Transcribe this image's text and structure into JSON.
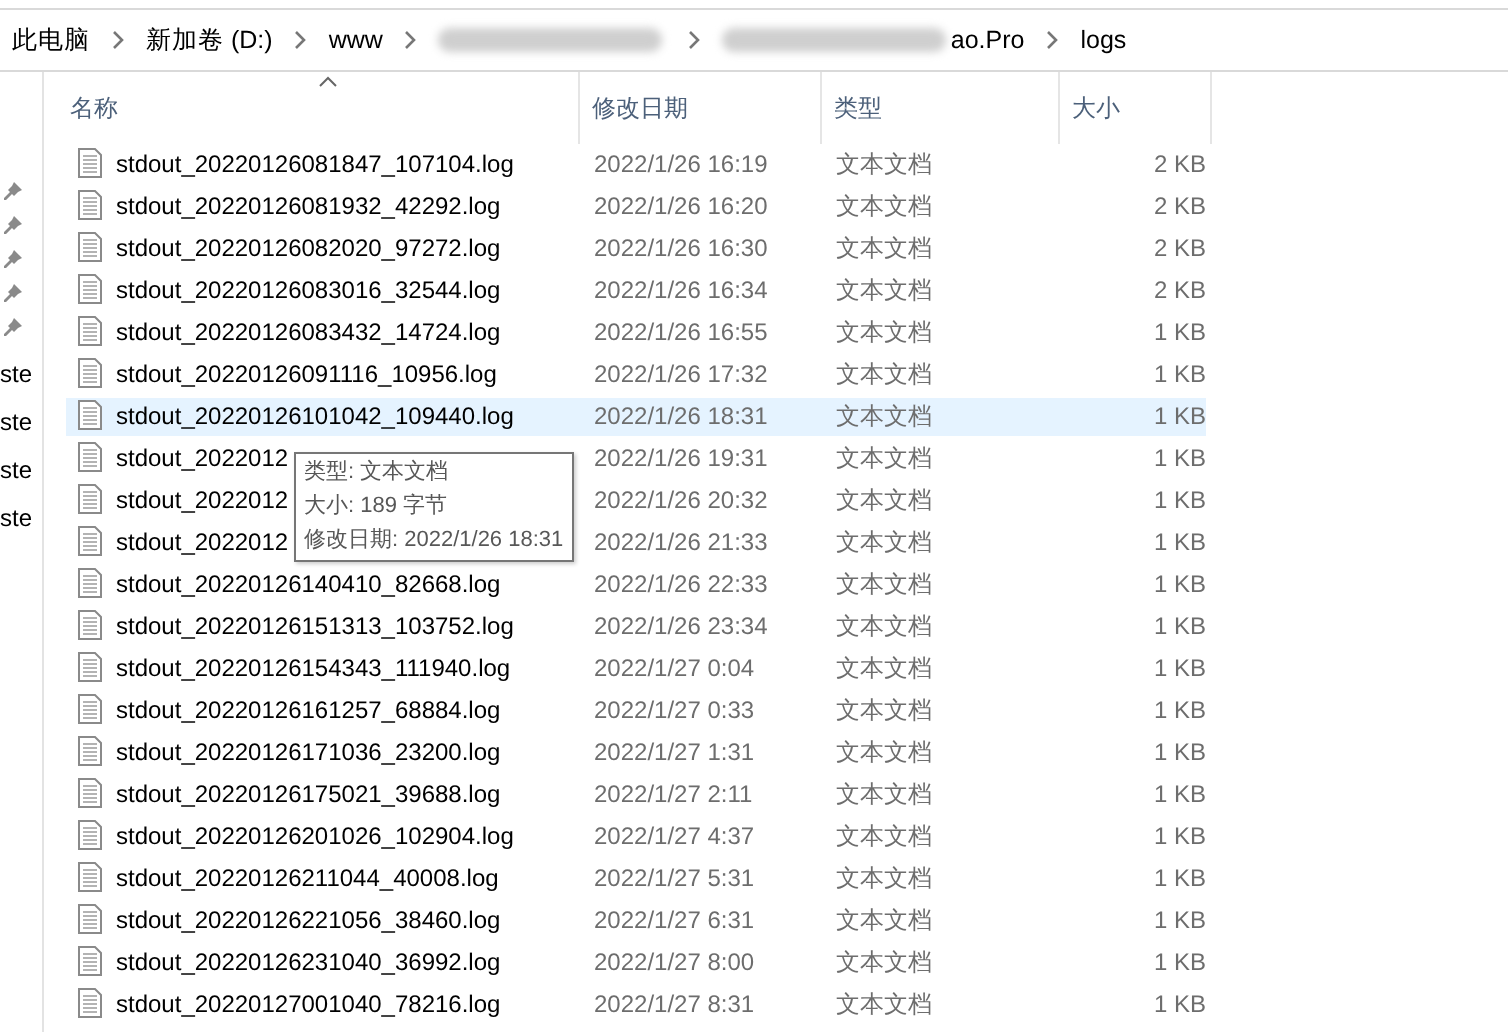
{
  "breadcrumb": [
    {
      "label": "此电脑",
      "redacted": false
    },
    {
      "label": "新加卷 (D:)",
      "redacted": false
    },
    {
      "label": "www",
      "redacted": false
    },
    {
      "redacted": true
    },
    {
      "label": "ao.Pro",
      "redacted": true
    },
    {
      "label": "logs",
      "redacted": false
    }
  ],
  "nav_pane": [
    {
      "kind": "pin"
    },
    {
      "kind": "pin"
    },
    {
      "kind": "pin"
    },
    {
      "kind": "pin"
    },
    {
      "kind": "pin"
    },
    {
      "kind": "text",
      "label": "ste"
    },
    {
      "kind": "text",
      "label": "ste"
    },
    {
      "kind": "text",
      "label": "ste"
    },
    {
      "kind": "text",
      "label": "ste"
    }
  ],
  "columns": [
    "名称",
    "修改日期",
    "类型",
    "大小"
  ],
  "rows": [
    {
      "name": "stdout_20220126081847_107104.log",
      "date": "2022/1/26 16:19",
      "type": "文本文档",
      "size": "2 KB",
      "selected": false
    },
    {
      "name": "stdout_20220126081932_42292.log",
      "date": "2022/1/26 16:20",
      "type": "文本文档",
      "size": "2 KB",
      "selected": false
    },
    {
      "name": "stdout_20220126082020_97272.log",
      "date": "2022/1/26 16:30",
      "type": "文本文档",
      "size": "2 KB",
      "selected": false
    },
    {
      "name": "stdout_20220126083016_32544.log",
      "date": "2022/1/26 16:34",
      "type": "文本文档",
      "size": "2 KB",
      "selected": false
    },
    {
      "name": "stdout_20220126083432_14724.log",
      "date": "2022/1/26 16:55",
      "type": "文本文档",
      "size": "1 KB",
      "selected": false
    },
    {
      "name": "stdout_20220126091116_10956.log",
      "date": "2022/1/26 17:32",
      "type": "文本文档",
      "size": "1 KB",
      "selected": false
    },
    {
      "name": "stdout_20220126101042_109440.log",
      "date": "2022/1/26 18:31",
      "type": "文本文档",
      "size": "1 KB",
      "selected": true
    },
    {
      "name": "stdout_2022012",
      "date": "2022/1/26 19:31",
      "type": "文本文档",
      "size": "1 KB",
      "selected": false
    },
    {
      "name": "stdout_2022012",
      "date": "2022/1/26 20:32",
      "type": "文本文档",
      "size": "1 KB",
      "selected": false
    },
    {
      "name": "stdout_2022012",
      "date": "2022/1/26 21:33",
      "type": "文本文档",
      "size": "1 KB",
      "selected": false
    },
    {
      "name": "stdout_20220126140410_82668.log",
      "date": "2022/1/26 22:33",
      "type": "文本文档",
      "size": "1 KB",
      "selected": false
    },
    {
      "name": "stdout_20220126151313_103752.log",
      "date": "2022/1/26 23:34",
      "type": "文本文档",
      "size": "1 KB",
      "selected": false
    },
    {
      "name": "stdout_20220126154343_111940.log",
      "date": "2022/1/27 0:04",
      "type": "文本文档",
      "size": "1 KB",
      "selected": false
    },
    {
      "name": "stdout_20220126161257_68884.log",
      "date": "2022/1/27 0:33",
      "type": "文本文档",
      "size": "1 KB",
      "selected": false
    },
    {
      "name": "stdout_20220126171036_23200.log",
      "date": "2022/1/27 1:31",
      "type": "文本文档",
      "size": "1 KB",
      "selected": false
    },
    {
      "name": "stdout_20220126175021_39688.log",
      "date": "2022/1/27 2:11",
      "type": "文本文档",
      "size": "1 KB",
      "selected": false
    },
    {
      "name": "stdout_20220126201026_102904.log",
      "date": "2022/1/27 4:37",
      "type": "文本文档",
      "size": "1 KB",
      "selected": false
    },
    {
      "name": "stdout_20220126211044_40008.log",
      "date": "2022/1/27 5:31",
      "type": "文本文档",
      "size": "1 KB",
      "selected": false
    },
    {
      "name": "stdout_20220126221056_38460.log",
      "date": "2022/1/27 6:31",
      "type": "文本文档",
      "size": "1 KB",
      "selected": false
    },
    {
      "name": "stdout_20220126231040_36992.log",
      "date": "2022/1/27 8:00",
      "type": "文本文档",
      "size": "1 KB",
      "selected": false
    },
    {
      "name": "stdout_20220127001040_78216.log",
      "date": "2022/1/27 8:31",
      "type": "文本文档",
      "size": "1 KB",
      "selected": false
    }
  ],
  "tooltip": [
    "类型: 文本文档",
    "大小: 189 字节",
    "修改日期: 2022/1/26 18:31"
  ]
}
